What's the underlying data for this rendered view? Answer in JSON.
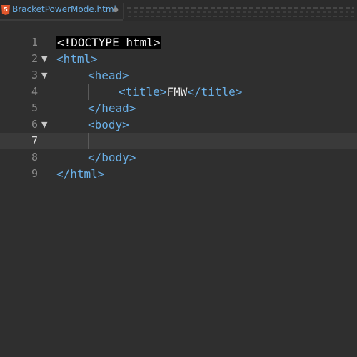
{
  "tab": {
    "file_name": "BracketPowerMode.html",
    "icon_label": "5",
    "modified_dot": "●"
  },
  "gutter": {
    "numbers": [
      "1",
      "2",
      "3",
      "4",
      "5",
      "6",
      "7",
      "8",
      "9"
    ],
    "fold_marker": "▼"
  },
  "code": {
    "line1": "<!DOCTYPE html>",
    "line2": "<html>",
    "line3": "<head>",
    "line4_open": "<title>",
    "line4_text": "FMW",
    "line4_close": "</title>",
    "line5": "</head>",
    "line6": "<body>",
    "line7": "",
    "line8": "</body>",
    "line9": "</html>"
  },
  "colors": {
    "background": "#2f2f2f",
    "tag": "#6ab0e8",
    "text": "#e6e6e6",
    "active_line": "#3a3a3a",
    "html5_icon": "#e2572c"
  }
}
